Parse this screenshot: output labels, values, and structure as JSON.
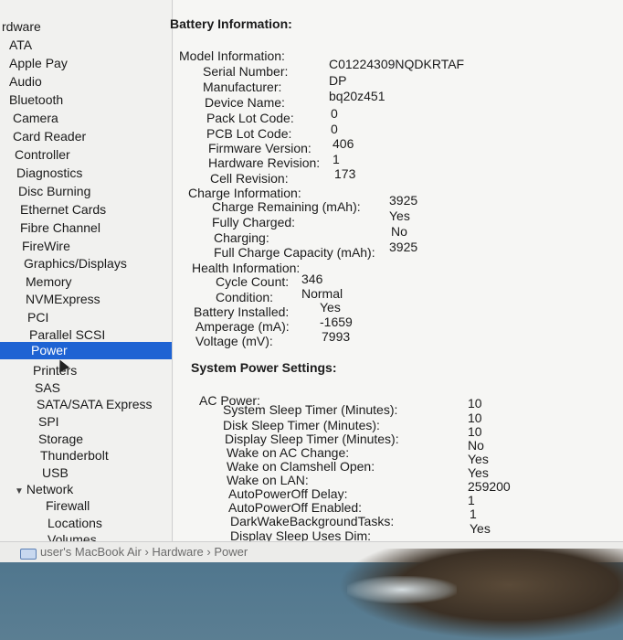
{
  "sidebar": {
    "items": [
      {
        "label": "rdware",
        "level": "cat"
      },
      {
        "label": "ATA",
        "level": "l1"
      },
      {
        "label": "Apple Pay",
        "level": "l1"
      },
      {
        "label": "Audio",
        "level": "l1"
      },
      {
        "label": "Bluetooth",
        "level": "l1"
      },
      {
        "label": "Camera",
        "level": "l1"
      },
      {
        "label": "Card Reader",
        "level": "l1"
      },
      {
        "label": "Controller",
        "level": "l1"
      },
      {
        "label": "Diagnostics",
        "level": "l1"
      },
      {
        "label": "Disc Burning",
        "level": "l1"
      },
      {
        "label": "Ethernet Cards",
        "level": "l1"
      },
      {
        "label": "Fibre Channel",
        "level": "l1"
      },
      {
        "label": "FireWire",
        "level": "l1"
      },
      {
        "label": "Graphics/Displays",
        "level": "l1"
      },
      {
        "label": "Memory",
        "level": "l1"
      },
      {
        "label": "NVMExpress",
        "level": "l1"
      },
      {
        "label": "PCI",
        "level": "l1"
      },
      {
        "label": "Parallel SCSI",
        "level": "l1"
      },
      {
        "label": "Power",
        "level": "selected"
      },
      {
        "label": "Printers",
        "level": "l2"
      },
      {
        "label": "SAS",
        "level": "l2"
      },
      {
        "label": "SATA/SATA Express",
        "level": "l2"
      },
      {
        "label": "SPI",
        "level": "l2"
      },
      {
        "label": "Storage",
        "level": "l2"
      },
      {
        "label": "Thunderbolt",
        "level": "l2"
      },
      {
        "label": "USB",
        "level": "l2"
      },
      {
        "label": "Network",
        "level": "cat2"
      },
      {
        "label": "Firewall",
        "level": "l3"
      },
      {
        "label": "Locations",
        "level": "l3"
      },
      {
        "label": "Volumes",
        "level": "l3"
      }
    ]
  },
  "battery": {
    "title": "Battery Information:",
    "model_info": "Model Information:",
    "serial_label": "Serial Number:",
    "serial": "C01224309NQDKRTAF",
    "manufacturer_label": "Manufacturer:",
    "manufacturer": "DP",
    "device_label": "Device Name:",
    "device": "bq20z451",
    "pack_lot_label": "Pack Lot Code:",
    "pack_lot": "0",
    "pcb_lot_label": "PCB Lot Code:",
    "pcb_lot": "0",
    "firmware_label": "Firmware Version:",
    "firmware": "406",
    "hw_rev_label": "Hardware Revision:",
    "hw_rev": "1",
    "cell_rev_label": "Cell Revision:",
    "cell_rev": "173",
    "charge_info": "Charge Information:",
    "charge_remaining_label": "Charge Remaining (mAh):",
    "charge_remaining": "3925",
    "fully_charged_label": "Fully Charged:",
    "fully_charged": "Yes",
    "charging_label": "Charging:",
    "charging": "No",
    "full_capacity_label": "Full Charge Capacity (mAh):",
    "full_capacity": "3925",
    "health_info": "Health Information:",
    "cycle_label": "Cycle Count:",
    "cycle": "346",
    "condition_label": "Condition:",
    "condition": "Normal",
    "installed_label": "Battery Installed:",
    "installed": "Yes",
    "amperage_label": "Amperage (mA):",
    "amperage": "-1659",
    "voltage_label": "Voltage (mV):",
    "voltage": "7993"
  },
  "power": {
    "title": "System Power Settings:",
    "ac_power": "AC Power:",
    "rows": [
      {
        "label": "System Sleep Timer (Minutes):",
        "value": "10"
      },
      {
        "label": "Disk Sleep Timer (Minutes):",
        "value": "10"
      },
      {
        "label": "Display Sleep Timer (Minutes):",
        "value": "10"
      },
      {
        "label": "Wake on AC Change:",
        "value": "No"
      },
      {
        "label": "Wake on Clamshell Open:",
        "value": "Yes"
      },
      {
        "label": "Wake on LAN:",
        "value": "Yes"
      },
      {
        "label": "AutoPowerOff Delay:",
        "value": "259200"
      },
      {
        "label": "AutoPowerOff Enabled:",
        "value": "1"
      },
      {
        "label": "DarkWakeBackgroundTasks:",
        "value": "1"
      },
      {
        "label": "Display Sleep Uses Dim:",
        "value": "Yes"
      }
    ]
  },
  "statusbar": {
    "path": "user's MacBook Air › Hardware › Power"
  }
}
